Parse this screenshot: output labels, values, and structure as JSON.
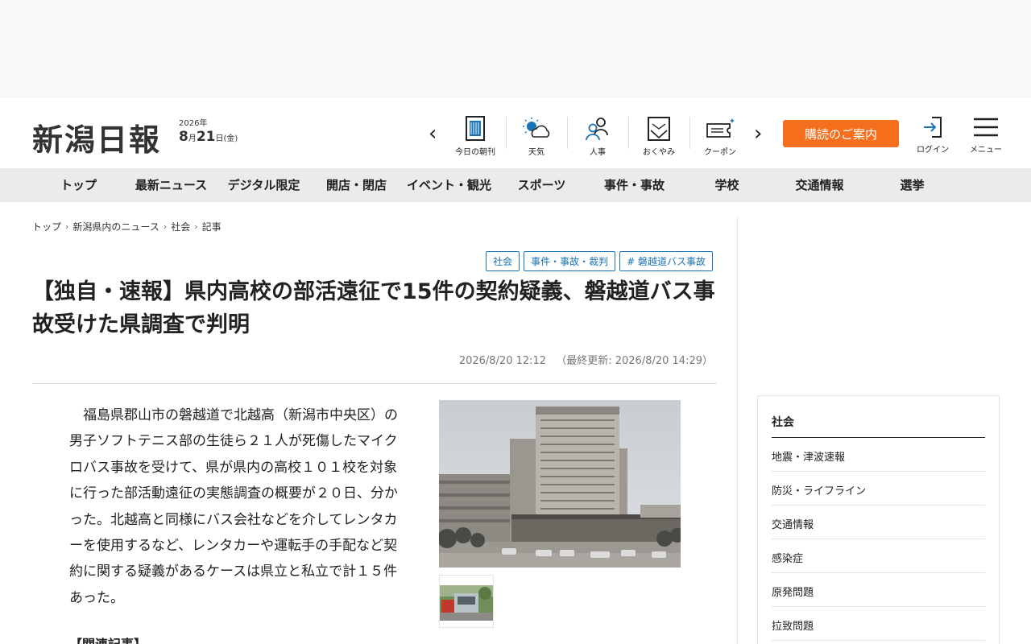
{
  "header": {
    "logo": "新潟日報",
    "date_year": "2026年",
    "date_month": "8",
    "date_day": "21",
    "date_weekday": "(金)",
    "quick_links": [
      {
        "label": "今日の朝刊",
        "icon": "newspaper-icon"
      },
      {
        "label": "天気",
        "icon": "weather-icon"
      },
      {
        "label": "人事",
        "icon": "people-icon"
      },
      {
        "label": "おくやみ",
        "icon": "condolence-icon"
      },
      {
        "label": "クーポン",
        "icon": "coupon-icon"
      }
    ],
    "subscribe_label": "購読のご案内",
    "login_label": "ログイン",
    "menu_label": "メニュー",
    "accent_color": "#f56f1c"
  },
  "nav": {
    "items": [
      "トップ",
      "最新ニュース",
      "デジタル限定",
      "開店・閉店",
      "イベント・観光",
      "スポーツ",
      "事件・事故",
      "学校",
      "交通情報",
      "選挙"
    ]
  },
  "breadcrumb": [
    "トップ",
    "新潟県内のニュース",
    "社会",
    "記事"
  ],
  "article": {
    "tags": [
      "社会",
      "事件・事故・裁判",
      "# 磐越道バス事故"
    ],
    "title": "【独自・速報】県内高校の部活遠征で15件の契約疑義、磐越道バス事故受けた県調査で判明",
    "published": "2026/8/20 12:12",
    "updated": "（最終更新: 2026/8/20 14:29）",
    "body": "福島県郡山市の磐越道で北越高（新潟市中央区）の男子ソフトテニス部の生徒ら２１人が死傷したマイクロバス事故を受けて、県が県内の高校１０１校を対象に行った部活動遠征の実態調査の概要が２０日、分かった。北越高と同様にバス会社などを介してレンタカーを使用するなど、レンタカーや運転手の手配など契約に関する疑義があるケースは県立と私立で計１５件あった。",
    "related_heading": "【関連記事】",
    "tag_color": "#1a73b5"
  },
  "sidebar": {
    "title": "社会",
    "items": [
      "地震・津波速報",
      "防災・ライフライン",
      "交通情報",
      "感染症",
      "原発問題",
      "拉致問題"
    ]
  }
}
